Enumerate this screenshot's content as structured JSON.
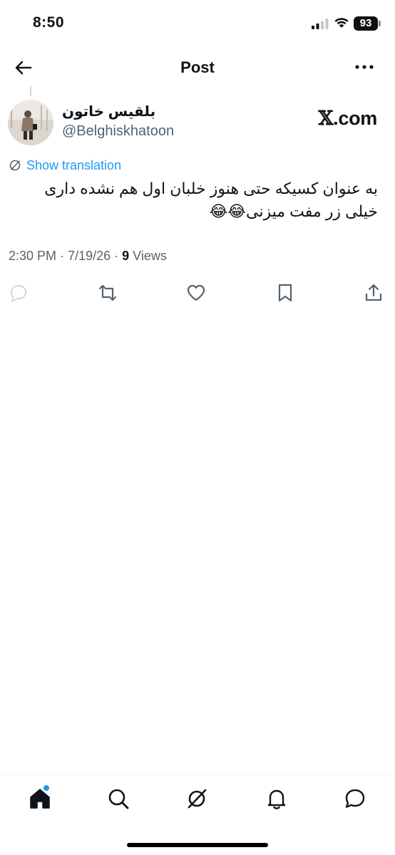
{
  "status_bar": {
    "time": "8:50",
    "battery": "93",
    "icons": [
      "signal-icon",
      "wifi-icon",
      "battery-icon"
    ]
  },
  "header": {
    "title": "Post",
    "back_icon": "arrow-left-icon",
    "more_icon": "more-horizontal-icon"
  },
  "post": {
    "author_name": "بلقیس خاتون",
    "author_handle": "@Belghiskhatoon",
    "source": {
      "x_glyph": "𝕏",
      "domain": ".com"
    },
    "translation_label": "Show translation",
    "text_line1": "به عنوان کسیکه حتی هنوز خلبان اول هم نشده  داری",
    "text_line2": "خیلی زر مفت میزنی😂😂",
    "time": "2:30 PM",
    "date": "7/19/26",
    "views_count": "9",
    "views_label": "Views"
  },
  "actions": [
    "reply-icon",
    "repost-icon",
    "like-icon",
    "bookmark-icon",
    "share-icon"
  ],
  "bottom_nav": {
    "items": [
      "home-icon",
      "search-icon",
      "grok-icon",
      "notifications-icon",
      "messages-icon"
    ],
    "active": "home-icon"
  },
  "colors": {
    "accent": "#1d9bf0",
    "text_primary": "#0f1419",
    "text_secondary": "#536471",
    "divider": "#eff3f4"
  }
}
